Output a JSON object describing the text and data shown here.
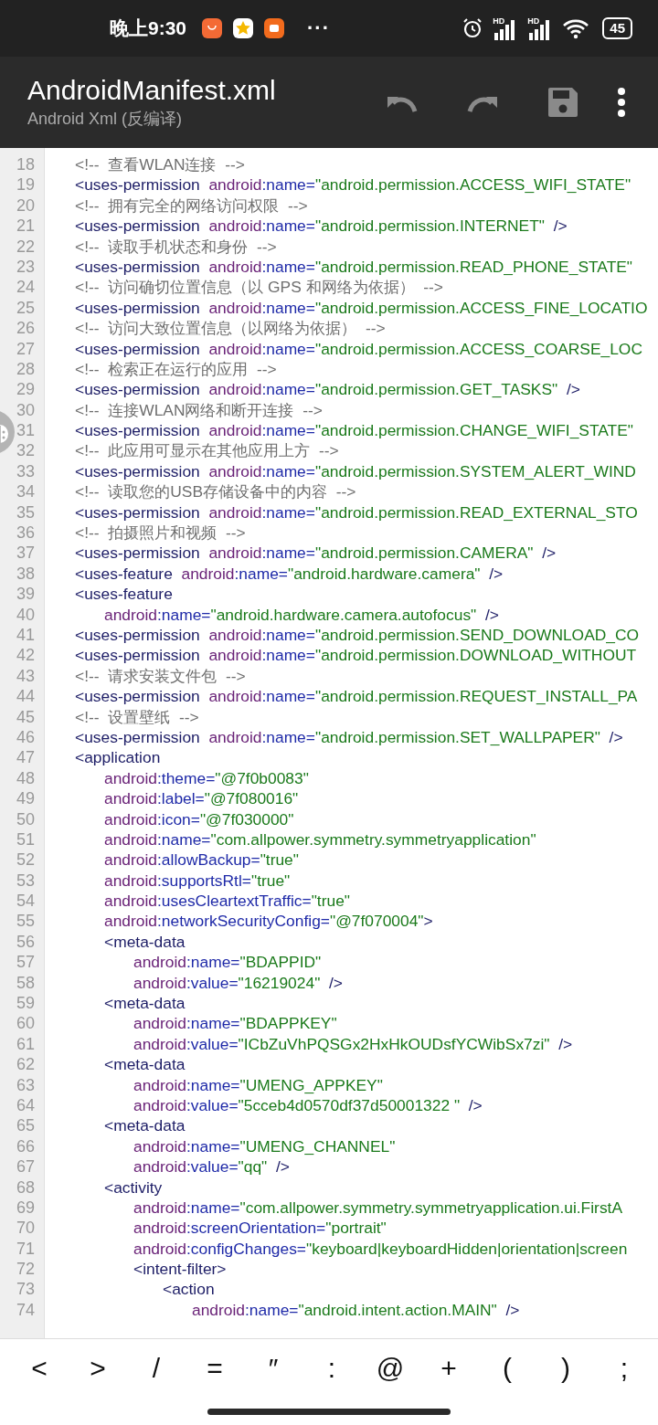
{
  "status_bar": {
    "time": "晚上9:30",
    "notifications": [
      {
        "kind": "bag"
      },
      {
        "kind": "star"
      },
      {
        "kind": "mi"
      }
    ],
    "more": "···",
    "signals": [
      {
        "label": "HD"
      },
      {
        "label": "HD"
      }
    ],
    "battery": "45"
  },
  "toolbar": {
    "title": "AndroidManifest.xml",
    "subtitle": "Android Xml (反编译)",
    "actions": [
      {
        "kind": "undo",
        "disabled": true
      },
      {
        "kind": "redo",
        "disabled": true
      },
      {
        "kind": "save",
        "disabled": true
      },
      {
        "kind": "more",
        "disabled": false
      }
    ]
  },
  "code": {
    "lines": [
      {
        "number": "18",
        "tokens": [
          {
            "kind": "comment",
            "text": "<!--  查看WLAN连接  -->"
          }
        ]
      },
      {
        "number": "19",
        "tokens": [
          {
            "kind": "tag",
            "text": "<uses-permission"
          },
          {
            "kind": "ns",
            "text": "  android"
          },
          {
            "kind": "attr",
            "text": ":name="
          },
          {
            "kind": "value",
            "text": "\"android.permission.ACCESS_WIFI_STATE\""
          }
        ]
      },
      {
        "number": "20",
        "tokens": [
          {
            "kind": "comment",
            "text": "<!--  拥有完全的网络访问权限  -->"
          }
        ]
      },
      {
        "number": "21",
        "tokens": [
          {
            "kind": "tag",
            "text": "<uses-permission"
          },
          {
            "kind": "ns",
            "text": "  android"
          },
          {
            "kind": "attr",
            "text": ":name="
          },
          {
            "kind": "value",
            "text": "\"android.permission.INTERNET\""
          },
          {
            "kind": "tag",
            "text": "  />"
          }
        ]
      },
      {
        "number": "22",
        "tokens": [
          {
            "kind": "comment",
            "text": "<!--  读取手机状态和身份  -->"
          }
        ]
      },
      {
        "number": "23",
        "tokens": [
          {
            "kind": "tag",
            "text": "<uses-permission"
          },
          {
            "kind": "ns",
            "text": "  android"
          },
          {
            "kind": "attr",
            "text": ":name="
          },
          {
            "kind": "value",
            "text": "\"android.permission.READ_PHONE_STATE\""
          }
        ]
      },
      {
        "number": "24",
        "tokens": [
          {
            "kind": "comment",
            "text": "<!--  访问确切位置信息（以 GPS 和网络为依据）  -->"
          }
        ]
      },
      {
        "number": "25",
        "tokens": [
          {
            "kind": "tag",
            "text": "<uses-permission"
          },
          {
            "kind": "ns",
            "text": "  android"
          },
          {
            "kind": "attr",
            "text": ":name="
          },
          {
            "kind": "value",
            "text": "\"android.permission.ACCESS_FINE_LOCATIO"
          }
        ]
      },
      {
        "number": "26",
        "tokens": [
          {
            "kind": "comment",
            "text": "<!--  访问大致位置信息（以网络为依据）  -->"
          }
        ]
      },
      {
        "number": "27",
        "tokens": [
          {
            "kind": "tag",
            "text": "<uses-permission"
          },
          {
            "kind": "ns",
            "text": "  android"
          },
          {
            "kind": "attr",
            "text": ":name="
          },
          {
            "kind": "value",
            "text": "\"android.permission.ACCESS_COARSE_LOC"
          }
        ]
      },
      {
        "number": "28",
        "tokens": [
          {
            "kind": "comment",
            "text": "<!--  检索正在运行的应用  -->"
          }
        ]
      },
      {
        "number": "29",
        "tokens": [
          {
            "kind": "tag",
            "text": "<uses-permission"
          },
          {
            "kind": "ns",
            "text": "  android"
          },
          {
            "kind": "attr",
            "text": ":name="
          },
          {
            "kind": "value",
            "text": "\"android.permission.GET_TASKS\""
          },
          {
            "kind": "tag",
            "text": "  />"
          }
        ]
      },
      {
        "number": "30",
        "tokens": [
          {
            "kind": "comment",
            "text": "<!--  连接WLAN网络和断开连接  -->"
          }
        ]
      },
      {
        "number": "31",
        "tokens": [
          {
            "kind": "tag",
            "text": "<uses-permission"
          },
          {
            "kind": "ns",
            "text": "  android"
          },
          {
            "kind": "attr",
            "text": ":name="
          },
          {
            "kind": "value",
            "text": "\"android.permission.CHANGE_WIFI_STATE\""
          }
        ]
      },
      {
        "number": "32",
        "tokens": [
          {
            "kind": "comment",
            "text": "<!--  此应用可显示在其他应用上方  -->"
          }
        ]
      },
      {
        "number": "33",
        "tokens": [
          {
            "kind": "tag",
            "text": "<uses-permission"
          },
          {
            "kind": "ns",
            "text": "  android"
          },
          {
            "kind": "attr",
            "text": ":name="
          },
          {
            "kind": "value",
            "text": "\"android.permission.SYSTEM_ALERT_WIND"
          }
        ]
      },
      {
        "number": "34",
        "tokens": [
          {
            "kind": "comment",
            "text": "<!--  读取您的USB存储设备中的内容  -->"
          }
        ]
      },
      {
        "number": "35",
        "tokens": [
          {
            "kind": "tag",
            "text": "<uses-permission"
          },
          {
            "kind": "ns",
            "text": "  android"
          },
          {
            "kind": "attr",
            "text": ":name="
          },
          {
            "kind": "value",
            "text": "\"android.permission.READ_EXTERNAL_STO"
          }
        ]
      },
      {
        "number": "36",
        "tokens": [
          {
            "kind": "comment",
            "text": "<!--  拍摄照片和视频  -->"
          }
        ]
      },
      {
        "number": "37",
        "tokens": [
          {
            "kind": "tag",
            "text": "<uses-permission"
          },
          {
            "kind": "ns",
            "text": "  android"
          },
          {
            "kind": "attr",
            "text": ":name="
          },
          {
            "kind": "value",
            "text": "\"android.permission.CAMERA\""
          },
          {
            "kind": "tag",
            "text": "  />"
          }
        ]
      },
      {
        "number": "38",
        "tokens": [
          {
            "kind": "tag",
            "text": "<uses-feature"
          },
          {
            "kind": "ns",
            "text": "  android"
          },
          {
            "kind": "attr",
            "text": ":name="
          },
          {
            "kind": "value",
            "text": "\"android.hardware.camera\""
          },
          {
            "kind": "tag",
            "text": "  />"
          }
        ]
      },
      {
        "number": "39",
        "tokens": [
          {
            "kind": "tag",
            "text": "<uses-feature"
          }
        ],
        "children": [
          {
            "number": "40",
            "tokens": [
              {
                "kind": "ns",
                "text": "android"
              },
              {
                "kind": "attr",
                "text": ":name="
              },
              {
                "kind": "value",
                "text": "\"android.hardware.camera.autofocus\""
              },
              {
                "kind": "tag",
                "text": "  />"
              }
            ]
          }
        ]
      },
      {
        "number": "41",
        "tokens": [
          {
            "kind": "tag",
            "text": "<uses-permission"
          },
          {
            "kind": "ns",
            "text": "  android"
          },
          {
            "kind": "attr",
            "text": ":name="
          },
          {
            "kind": "value",
            "text": "\"android.permission.SEND_DOWNLOAD_CO"
          }
        ]
      },
      {
        "number": "42",
        "tokens": [
          {
            "kind": "tag",
            "text": "<uses-permission"
          },
          {
            "kind": "ns",
            "text": "  android"
          },
          {
            "kind": "attr",
            "text": ":name="
          },
          {
            "kind": "value",
            "text": "\"android.permission.DOWNLOAD_WITHOUT"
          }
        ]
      },
      {
        "number": "43",
        "tokens": [
          {
            "kind": "comment",
            "text": "<!--  请求安装文件包  -->"
          }
        ]
      },
      {
        "number": "44",
        "tokens": [
          {
            "kind": "tag",
            "text": "<uses-permission"
          },
          {
            "kind": "ns",
            "text": "  android"
          },
          {
            "kind": "attr",
            "text": ":name="
          },
          {
            "kind": "value",
            "text": "\"android.permission.REQUEST_INSTALL_PA"
          }
        ]
      },
      {
        "number": "45",
        "tokens": [
          {
            "kind": "comment",
            "text": "<!--  设置壁纸  -->"
          }
        ]
      },
      {
        "number": "46",
        "tokens": [
          {
            "kind": "tag",
            "text": "<uses-permission"
          },
          {
            "kind": "ns",
            "text": "  android"
          },
          {
            "kind": "attr",
            "text": ":name="
          },
          {
            "kind": "value",
            "text": "\"android.permission.SET_WALLPAPER\""
          },
          {
            "kind": "tag",
            "text": "  />"
          }
        ]
      },
      {
        "number": "47",
        "tokens": [
          {
            "kind": "tag",
            "text": "<application"
          }
        ],
        "children": [
          {
            "number": "48",
            "tokens": [
              {
                "kind": "ns",
                "text": "android"
              },
              {
                "kind": "attr",
                "text": ":theme="
              },
              {
                "kind": "value",
                "text": "\"@7f0b0083\""
              }
            ]
          },
          {
            "number": "49",
            "tokens": [
              {
                "kind": "ns",
                "text": "android"
              },
              {
                "kind": "attr",
                "text": ":label="
              },
              {
                "kind": "value",
                "text": "\"@7f080016\""
              }
            ]
          },
          {
            "number": "50",
            "tokens": [
              {
                "kind": "ns",
                "text": "android"
              },
              {
                "kind": "attr",
                "text": ":icon="
              },
              {
                "kind": "value",
                "text": "\"@7f030000\""
              }
            ]
          },
          {
            "number": "51",
            "tokens": [
              {
                "kind": "ns",
                "text": "android"
              },
              {
                "kind": "attr",
                "text": ":name="
              },
              {
                "kind": "value",
                "text": "\"com.allpower.symmetry.symmetryapplication\""
              }
            ]
          },
          {
            "number": "52",
            "tokens": [
              {
                "kind": "ns",
                "text": "android"
              },
              {
                "kind": "attr",
                "text": ":allowBackup="
              },
              {
                "kind": "value",
                "text": "\"true\""
              }
            ]
          },
          {
            "number": "53",
            "tokens": [
              {
                "kind": "ns",
                "text": "android"
              },
              {
                "kind": "attr",
                "text": ":supportsRtl="
              },
              {
                "kind": "value",
                "text": "\"true\""
              }
            ]
          },
          {
            "number": "54",
            "tokens": [
              {
                "kind": "ns",
                "text": "android"
              },
              {
                "kind": "attr",
                "text": ":usesCleartextTraffic="
              },
              {
                "kind": "value",
                "text": "\"true\""
              }
            ]
          },
          {
            "number": "55",
            "tokens": [
              {
                "kind": "ns",
                "text": "android"
              },
              {
                "kind": "attr",
                "text": ":networkSecurityConfig="
              },
              {
                "kind": "value",
                "text": "\"@7f070004\""
              },
              {
                "kind": "tag",
                "text": ">"
              }
            ]
          },
          {
            "number": "56",
            "tokens": [
              {
                "kind": "tag",
                "text": "<meta-data"
              }
            ],
            "children": [
              {
                "number": "57",
                "tokens": [
                  {
                    "kind": "ns",
                    "text": "android"
                  },
                  {
                    "kind": "attr",
                    "text": ":name="
                  },
                  {
                    "kind": "value",
                    "text": "\"BDAPPID\""
                  }
                ]
              },
              {
                "number": "58",
                "tokens": [
                  {
                    "kind": "ns",
                    "text": "android"
                  },
                  {
                    "kind": "attr",
                    "text": ":value="
                  },
                  {
                    "kind": "value",
                    "text": "\"16219024\""
                  },
                  {
                    "kind": "tag",
                    "text": "  />"
                  }
                ]
              }
            ]
          },
          {
            "number": "59",
            "tokens": [
              {
                "kind": "tag",
                "text": "<meta-data"
              }
            ],
            "children": [
              {
                "number": "60",
                "tokens": [
                  {
                    "kind": "ns",
                    "text": "android"
                  },
                  {
                    "kind": "attr",
                    "text": ":name="
                  },
                  {
                    "kind": "value",
                    "text": "\"BDAPPKEY\""
                  }
                ]
              },
              {
                "number": "61",
                "tokens": [
                  {
                    "kind": "ns",
                    "text": "android"
                  },
                  {
                    "kind": "attr",
                    "text": ":value="
                  },
                  {
                    "kind": "value",
                    "text": "\"ICbZuVhPQSGx2HxHkOUDsfYCWibSx7zi\""
                  },
                  {
                    "kind": "tag",
                    "text": "  />"
                  }
                ]
              }
            ]
          },
          {
            "number": "62",
            "tokens": [
              {
                "kind": "tag",
                "text": "<meta-data"
              }
            ],
            "children": [
              {
                "number": "63",
                "tokens": [
                  {
                    "kind": "ns",
                    "text": "android"
                  },
                  {
                    "kind": "attr",
                    "text": ":name="
                  },
                  {
                    "kind": "value",
                    "text": "\"UMENG_APPKEY\""
                  }
                ]
              },
              {
                "number": "64",
                "tokens": [
                  {
                    "kind": "ns",
                    "text": "android"
                  },
                  {
                    "kind": "attr",
                    "text": ":value="
                  },
                  {
                    "kind": "value",
                    "text": "\"5cceb4d0570df37d50001322 \""
                  },
                  {
                    "kind": "tag",
                    "text": "  />"
                  }
                ]
              }
            ]
          },
          {
            "number": "65",
            "tokens": [
              {
                "kind": "tag",
                "text": "<meta-data"
              }
            ],
            "children": [
              {
                "number": "66",
                "tokens": [
                  {
                    "kind": "ns",
                    "text": "android"
                  },
                  {
                    "kind": "attr",
                    "text": ":name="
                  },
                  {
                    "kind": "value",
                    "text": "\"UMENG_CHANNEL\""
                  }
                ]
              },
              {
                "number": "67",
                "tokens": [
                  {
                    "kind": "ns",
                    "text": "android"
                  },
                  {
                    "kind": "attr",
                    "text": ":value="
                  },
                  {
                    "kind": "value",
                    "text": "\"qq\""
                  },
                  {
                    "kind": "tag",
                    "text": "  />"
                  }
                ]
              }
            ]
          },
          {
            "number": "68",
            "tokens": [
              {
                "kind": "tag",
                "text": "<activity"
              }
            ],
            "children": [
              {
                "number": "69",
                "tokens": [
                  {
                    "kind": "ns",
                    "text": "android"
                  },
                  {
                    "kind": "attr",
                    "text": ":name="
                  },
                  {
                    "kind": "value",
                    "text": "\"com.allpower.symmetry.symmetryapplication.ui.FirstA"
                  }
                ]
              },
              {
                "number": "70",
                "tokens": [
                  {
                    "kind": "ns",
                    "text": "android"
                  },
                  {
                    "kind": "attr",
                    "text": ":screenOrientation="
                  },
                  {
                    "kind": "value",
                    "text": "\"portrait\""
                  }
                ]
              },
              {
                "number": "71",
                "tokens": [
                  {
                    "kind": "ns",
                    "text": "android"
                  },
                  {
                    "kind": "attr",
                    "text": ":configChanges="
                  },
                  {
                    "kind": "value",
                    "text": "\"keyboard|keyboardHidden|orientation|screen"
                  }
                ]
              },
              {
                "number": "72",
                "tokens": [
                  {
                    "kind": "tag",
                    "text": "<intent-filter>"
                  }
                ],
                "children": [
                  {
                    "number": "73",
                    "tokens": [
                      {
                        "kind": "tag",
                        "text": "<action"
                      }
                    ],
                    "children": [
                      {
                        "number": "74",
                        "tokens": [
                          {
                            "kind": "ns",
                            "text": "android"
                          },
                          {
                            "kind": "attr",
                            "text": ":name="
                          },
                          {
                            "kind": "value",
                            "text": "\"android.intent.action.MAIN\""
                          },
                          {
                            "kind": "tag",
                            "text": "  />"
                          }
                        ]
                      }
                    ]
                  }
                ]
              }
            ]
          }
        ]
      }
    ]
  },
  "symbol_keys": [
    "<",
    ">",
    "/",
    "=",
    "″",
    ":",
    "@",
    "+",
    "(",
    ")",
    ";"
  ]
}
